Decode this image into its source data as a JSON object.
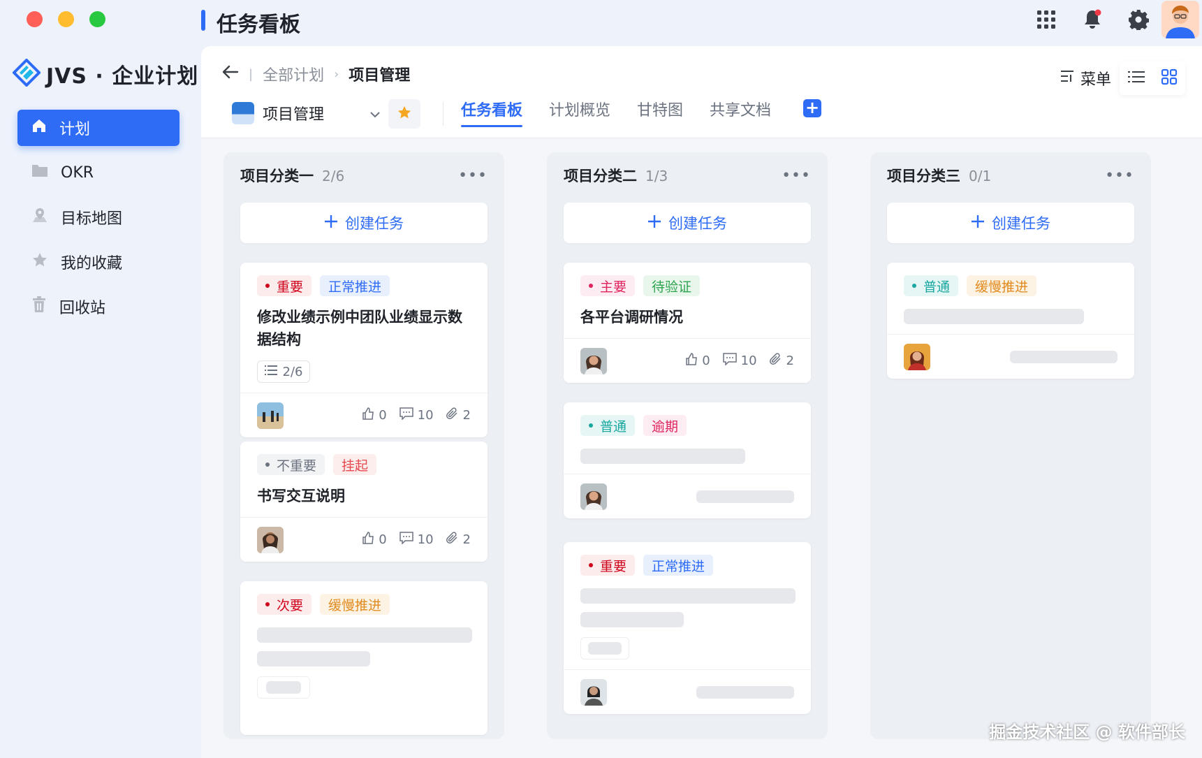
{
  "window": {
    "title": "任务看板",
    "traffic_colors": [
      "#ff5f57",
      "#febc2e",
      "#28c840"
    ]
  },
  "top_icons": [
    "grid-apps-icon",
    "bell-icon",
    "gear-icon",
    "user-avatar"
  ],
  "brand": {
    "name": "JVS · 企业计划"
  },
  "sidebar": {
    "items": [
      {
        "label": "计划",
        "icon": "home-icon",
        "active": true
      },
      {
        "label": "OKR",
        "icon": "folder-icon",
        "active": false
      },
      {
        "label": "目标地图",
        "icon": "map-pin-icon",
        "active": false
      },
      {
        "label": "我的收藏",
        "icon": "star-icon",
        "active": false
      },
      {
        "label": "回收站",
        "icon": "trash-icon",
        "active": false
      }
    ]
  },
  "breadcrumb": {
    "root": "全部计划",
    "current": "项目管理"
  },
  "project_select": {
    "value": "项目管理"
  },
  "tabs": [
    {
      "label": "任务看板",
      "active": true
    },
    {
      "label": "计划概览",
      "active": false
    },
    {
      "label": "甘特图",
      "active": false
    },
    {
      "label": "共享文档",
      "active": false
    }
  ],
  "menu_label": "菜单",
  "colors": {
    "accent": "#2f6cf6"
  },
  "board": {
    "create_label": "创建任务",
    "columns": [
      {
        "title": "项目分类一",
        "count": "2/6",
        "cards": [
          {
            "tags": [
              {
                "text": "重要",
                "fg": "#d0021b",
                "bg": "#fdecec",
                "dot": true
              },
              {
                "text": "正常推进",
                "fg": "#2f6cf6",
                "bg": "#e8f0fe",
                "dot": false
              }
            ],
            "title": "修改业绩示例中团队业绩显示数据结构",
            "subtask": "2/6",
            "likes": "0",
            "comments": "10",
            "attachments": "2"
          },
          {
            "tags": [
              {
                "text": "不重要",
                "fg": "#6b7280",
                "bg": "#f2f3f5",
                "dot": true
              },
              {
                "text": "挂起",
                "fg": "#e5484d",
                "bg": "#fdeeee",
                "dot": false
              }
            ],
            "title": "书写交互说明",
            "likes": "0",
            "comments": "10",
            "attachments": "2"
          },
          {
            "tags": [
              {
                "text": "次要",
                "fg": "#d0021b",
                "bg": "#fdecec",
                "dot": true
              },
              {
                "text": "缓慢推进",
                "fg": "#e08a1e",
                "bg": "#fdf3e4",
                "dot": false
              }
            ]
          }
        ]
      },
      {
        "title": "项目分类二",
        "count": "1/3",
        "cards": [
          {
            "tags": [
              {
                "text": "主要",
                "fg": "#e0245e",
                "bg": "#fdecf1",
                "dot": true
              },
              {
                "text": "待验证",
                "fg": "#2ea44f",
                "bg": "#e8f6ec",
                "dot": false
              }
            ],
            "title": "各平台调研情况",
            "likes": "0",
            "comments": "10",
            "attachments": "2"
          },
          {
            "tags": [
              {
                "text": "普通",
                "fg": "#1aa7a0",
                "bg": "#e5f6f5",
                "dot": true
              },
              {
                "text": "逾期",
                "fg": "#e0245e",
                "bg": "#fdecf1",
                "dot": false
              }
            ]
          },
          {
            "tags": [
              {
                "text": "重要",
                "fg": "#d0021b",
                "bg": "#fdecec",
                "dot": true
              },
              {
                "text": "正常推进",
                "fg": "#2f6cf6",
                "bg": "#e8f0fe",
                "dot": false
              }
            ]
          }
        ]
      },
      {
        "title": "项目分类三",
        "count": "0/1",
        "cards": [
          {
            "tags": [
              {
                "text": "普通",
                "fg": "#1aa7a0",
                "bg": "#e5f6f5",
                "dot": true
              },
              {
                "text": "缓慢推进",
                "fg": "#e08a1e",
                "bg": "#fdf3e4",
                "dot": false
              }
            ]
          }
        ]
      }
    ]
  },
  "watermark": "掘金技术社区 @ 软件部长"
}
